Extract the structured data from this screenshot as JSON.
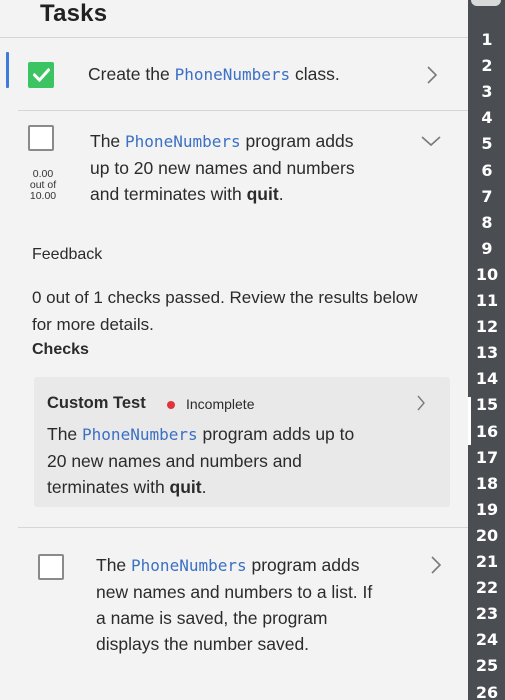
{
  "header": {
    "title": "Tasks"
  },
  "tasks": [
    {
      "checked": true,
      "text_before": "Create the ",
      "code": "PhoneNumbers",
      "text_after": " class."
    },
    {
      "checked": false,
      "score": {
        "value": "0.00",
        "out_of_label": "out of",
        "max": "10.00"
      },
      "line1_before": "The ",
      "line1_code": "PhoneNumbers",
      "line1_after": " program adds",
      "line2": "up to 20 new names and numbers",
      "line3_before": "and terminates with ",
      "line3_bold": "quit",
      "line3_after": "."
    },
    {
      "checked": false,
      "line1_before": "The ",
      "line1_code": "PhoneNumbers",
      "line1_after": " program adds",
      "line2": "new names and numbers to a list. If",
      "line3": "a name is saved, the program",
      "line4": "displays the number saved."
    }
  ],
  "feedback": {
    "label": "Feedback",
    "summary": "0 out of 1 checks passed. Review the results below for more details.",
    "checks_label": "Checks",
    "custom_test": {
      "title": "Custom Test",
      "status": "Incomplete",
      "status_color": "#e0343c",
      "line1_before": "The ",
      "line1_code": "PhoneNumbers",
      "line1_after": " program adds up to",
      "line2": "20 new names and numbers and",
      "line3_before": "terminates with ",
      "line3_bold": "quit",
      "line3_after": "."
    }
  },
  "line_numbers": [
    "1",
    "2",
    "3",
    "4",
    "5",
    "6",
    "7",
    "8",
    "9",
    "10",
    "11",
    "12",
    "13",
    "14",
    "15",
    "16",
    "17",
    "18",
    "19",
    "20",
    "21",
    "22",
    "23",
    "24",
    "25",
    "26"
  ],
  "colors": {
    "accent": "#3b7dd8",
    "success": "#3cc463",
    "code": "#3b70c4",
    "gutter": "#4a4d52"
  }
}
